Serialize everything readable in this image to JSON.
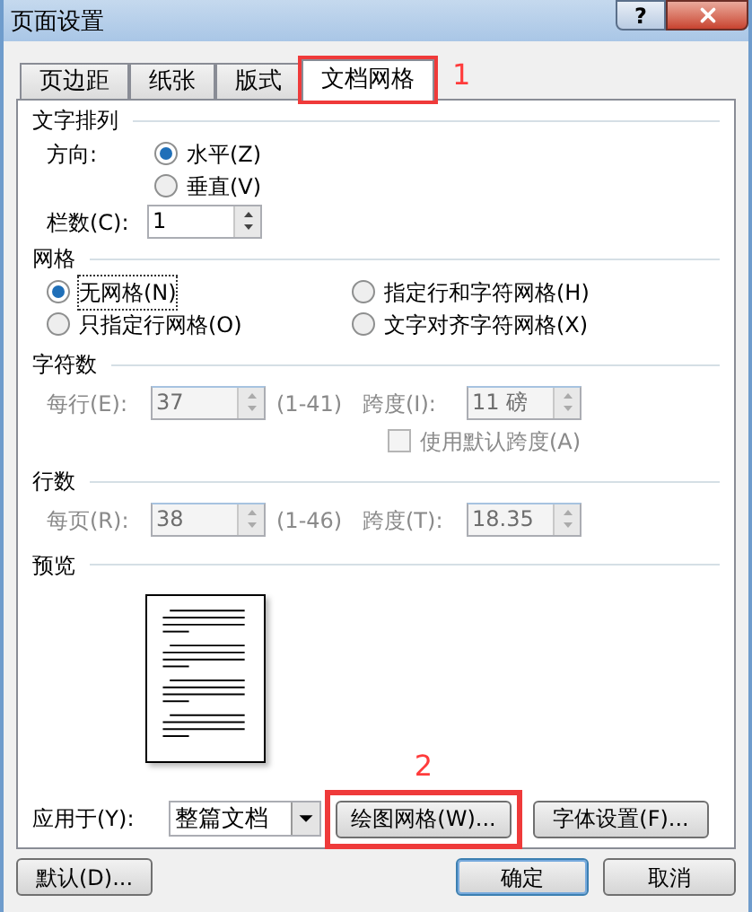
{
  "window": {
    "title": "页面设置",
    "help": "?"
  },
  "tabs": [
    {
      "label": "页边距",
      "selected": false
    },
    {
      "label": "纸张",
      "selected": false
    },
    {
      "label": "版式",
      "selected": false
    },
    {
      "label": "文档网格",
      "selected": true
    }
  ],
  "callouts": [
    "1",
    "2"
  ],
  "text_direction": {
    "heading": "文字排列",
    "direction_label": "方向:",
    "options": [
      {
        "label": "水平(Z)",
        "selected": true
      },
      {
        "label": "垂直(V)",
        "selected": false
      }
    ],
    "columns_label": "栏数(C):",
    "columns_value": "1"
  },
  "grid": {
    "heading": "网格",
    "options": [
      {
        "label": "无网格(N)",
        "selected": true
      },
      {
        "label": "指定行和字符网格(H)",
        "selected": false
      },
      {
        "label": "只指定行网格(O)",
        "selected": false
      },
      {
        "label": "文字对齐字符网格(X)",
        "selected": false
      }
    ]
  },
  "characters": {
    "heading": "字符数",
    "disabled": true,
    "count_label": "每行(E):",
    "count_value": "37",
    "range": "(1-41)",
    "pitch_label": "跨度(I):",
    "pitch_value": "11 磅",
    "default_pitch": {
      "label": "使用默认跨度(A)",
      "checked": false
    }
  },
  "lines": {
    "heading": "行数",
    "disabled": true,
    "count_label": "每页(R):",
    "count_value": "38",
    "range": "(1-46)",
    "pitch_label": "跨度(T):",
    "pitch_value": "18.35"
  },
  "preview": {
    "heading": "预览"
  },
  "apply_to": {
    "label": "应用于(Y):",
    "value": "整篇文档"
  },
  "panel_buttons": [
    {
      "label": "绘图网格(W)...",
      "highlighted": true
    },
    {
      "label": "字体设置(F)...",
      "highlighted": false
    }
  ],
  "footer_buttons": [
    {
      "label": "默认(D)...",
      "default": false
    },
    {
      "label": "确定",
      "default": true
    },
    {
      "label": "取消",
      "default": false
    }
  ]
}
